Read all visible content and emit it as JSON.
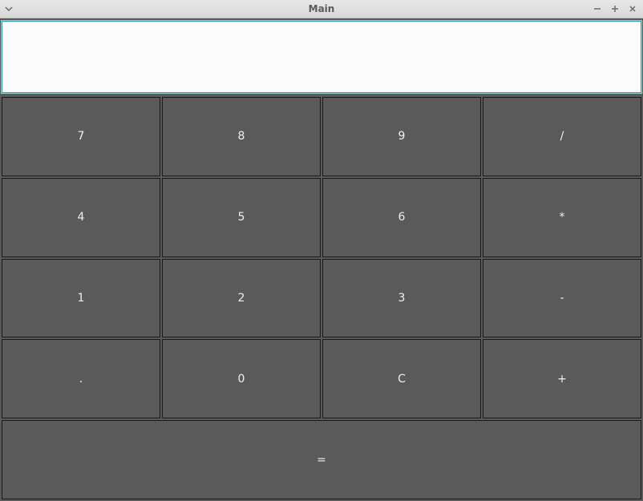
{
  "window": {
    "title": "Main"
  },
  "calculator": {
    "display_value": "",
    "buttons": {
      "r0c0": "7",
      "r0c1": "8",
      "r0c2": "9",
      "r0c3": "/",
      "r1c0": "4",
      "r1c1": "5",
      "r1c2": "6",
      "r1c3": "*",
      "r2c0": "1",
      "r2c1": "2",
      "r2c2": "3",
      "r2c3": "-",
      "r3c0": ".",
      "r3c1": "0",
      "r3c2": "C",
      "r3c3": "+",
      "equals": "="
    }
  }
}
